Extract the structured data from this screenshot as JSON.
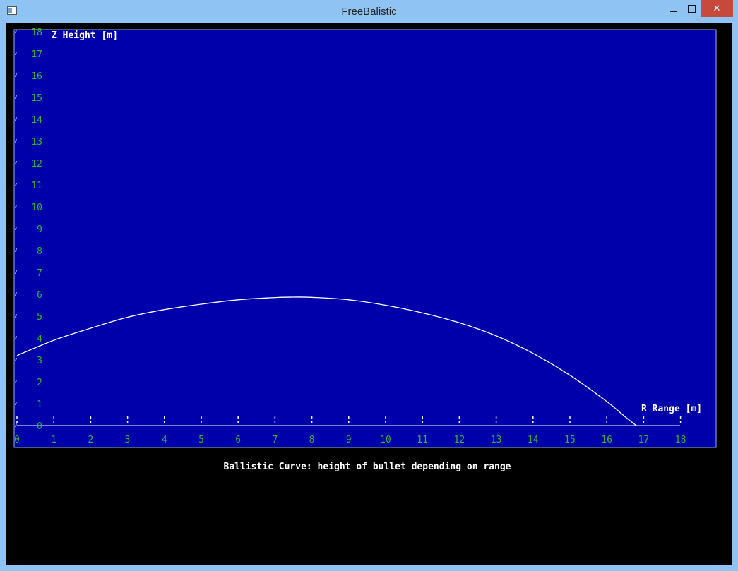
{
  "window": {
    "title": "FreeBalistic",
    "close_glyph": "✕",
    "icons": [
      "app-icon",
      "minimize-icon",
      "maximize-icon",
      "close-icon"
    ]
  },
  "colors": {
    "plot_background": "#0000aa",
    "tick_label": "#33b533",
    "curve": "#ffffff",
    "client_background": "#000000"
  },
  "chart_data": {
    "type": "line",
    "title": "",
    "caption": "Ballistic Curve: height of bullet depending on range",
    "xlabel": "R Range [m]",
    "ylabel": "Z Height [m]",
    "xlim": [
      0,
      18
    ],
    "ylim": [
      0,
      18
    ],
    "xticks": [
      "0",
      "1",
      "2",
      "3",
      "4",
      "5",
      "6",
      "7",
      "8",
      "9",
      "10",
      "11",
      "12",
      "13",
      "14",
      "15",
      "16",
      "17",
      "18"
    ],
    "yticks": [
      "0",
      "1",
      "2",
      "3",
      "4",
      "5",
      "6",
      "7",
      "8",
      "9",
      "10",
      "11",
      "12",
      "13",
      "14",
      "15",
      "16",
      "17",
      "18"
    ],
    "grid": false,
    "series": [
      {
        "x": [
          0,
          1,
          2,
          3,
          4,
          5,
          6,
          7,
          7.5,
          8,
          9,
          10,
          11,
          12,
          13,
          14,
          15,
          16,
          16.5,
          16.8
        ],
        "y": [
          3.2,
          3.9,
          4.45,
          4.95,
          5.3,
          5.55,
          5.75,
          5.85,
          5.87,
          5.86,
          5.75,
          5.5,
          5.15,
          4.7,
          4.1,
          3.3,
          2.3,
          1.1,
          0.4,
          0
        ]
      }
    ]
  }
}
